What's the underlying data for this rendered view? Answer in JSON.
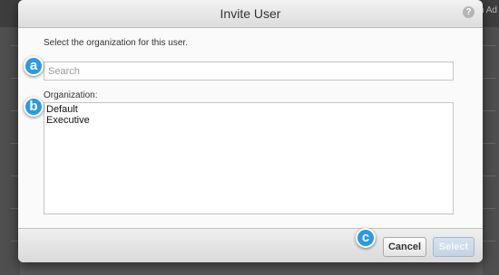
{
  "background": {
    "right_text": "n Ad"
  },
  "dialog": {
    "title": "Invite User",
    "help_icon": "help-icon",
    "instruction": "Select the organization for this user.",
    "search": {
      "placeholder": "Search",
      "value": ""
    },
    "organization_label": "Organization:",
    "organizations": [
      "Default",
      "Executive"
    ],
    "buttons": {
      "cancel": "Cancel",
      "select": "Select"
    }
  },
  "callouts": [
    "a",
    "b",
    "c"
  ],
  "colors": {
    "callout_badge": "#2b9ae0",
    "select_button_disabled": "#c4d3e4"
  }
}
